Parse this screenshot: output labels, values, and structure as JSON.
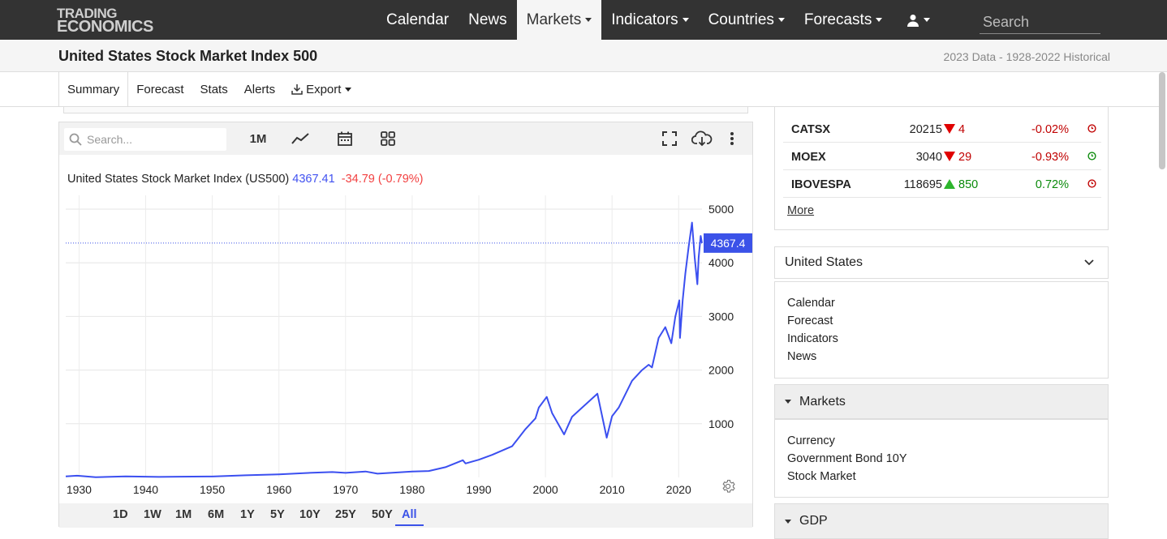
{
  "logo": {
    "line1": "TRADING",
    "line2": "ECONOMICS"
  },
  "nav": [
    {
      "label": "Calendar",
      "dropdown": false,
      "active": false
    },
    {
      "label": "News",
      "dropdown": false,
      "active": false
    },
    {
      "label": "Markets",
      "dropdown": true,
      "active": true
    },
    {
      "label": "Indicators",
      "dropdown": true,
      "active": false
    },
    {
      "label": "Countries",
      "dropdown": true,
      "active": false
    },
    {
      "label": "Forecasts",
      "dropdown": true,
      "active": false
    }
  ],
  "user_icon": "user-icon",
  "search": {
    "placeholder": "Search"
  },
  "page": {
    "title": "United States Stock Market Index 500",
    "meta": "2023 Data - 1928-2022 Historical"
  },
  "tabs": [
    "Summary",
    "Forecast",
    "Stats",
    "Alerts",
    "Export"
  ],
  "chart_toolbar": {
    "search_placeholder": "Search...",
    "interval": "1M",
    "icons": [
      "line-chart-icon",
      "calendar-icon",
      "grid-icon",
      "fullscreen-icon",
      "cloud-download-icon",
      "more-icon"
    ]
  },
  "legend": {
    "name": "United States Stock Market Index (US500)",
    "price": "4367.41",
    "change": "-34.79 (-0.79%)"
  },
  "ranges": [
    "1D",
    "1W",
    "1M",
    "6M",
    "1Y",
    "5Y",
    "10Y",
    "25Y",
    "50Y",
    "All"
  ],
  "active_range": "All",
  "colors": {
    "line": "#3b4ff0",
    "accent": "#3b52e8",
    "negative": "#c00000",
    "positive": "#0a8a0a",
    "nav_bg": "#333333"
  },
  "chart_data": {
    "type": "line",
    "title": "",
    "xlabel": "",
    "ylabel": "",
    "x_ticks": [
      "1930",
      "1940",
      "1950",
      "1960",
      "1970",
      "1980",
      "1990",
      "2000",
      "2010",
      "2020"
    ],
    "y_ticks": [
      "1000",
      "2000",
      "3000",
      "4000",
      "5000"
    ],
    "xlim": [
      1928,
      2023.5
    ],
    "ylim": [
      0,
      5000
    ],
    "last_value_label": "4367.4",
    "last_value": 4367.41,
    "series": [
      {
        "x": [
          1928,
          1929.7,
          1932.5,
          1937,
          1942,
          1945,
          1950,
          1955,
          1960,
          1965,
          1968,
          1970,
          1973,
          1974.8,
          1980,
          1982.5,
          1985,
          1987.6,
          1988,
          1990,
          1992,
          1995,
          1997,
          1998.5,
          1999,
          2000.2,
          2001,
          2002.8,
          2004,
          2007.8,
          2009.2,
          2010,
          2011,
          2013,
          2014.5,
          2015.5,
          2016,
          2017,
          2018,
          2018.9,
          2019.5,
          2020.1,
          2020.2,
          2020.6,
          2021,
          2021.5,
          2022,
          2022.4,
          2022.8,
          2023,
          2023.3,
          2023.5
        ],
        "y": [
          18,
          32,
          5,
          18,
          9,
          14,
          17,
          40,
          57,
          87,
          100,
          85,
          110,
          70,
          110,
          120,
          190,
          320,
          260,
          330,
          420,
          580,
          900,
          1100,
          1300,
          1500,
          1200,
          800,
          1130,
          1560,
          740,
          1140,
          1300,
          1800,
          2000,
          2100,
          2050,
          2600,
          2800,
          2500,
          3000,
          3300,
          2600,
          3300,
          3800,
          4300,
          4750,
          4100,
          3600,
          4100,
          4500,
          4367
        ]
      }
    ]
  },
  "markets": [
    {
      "name": "CATSX",
      "value": "20215",
      "dir": "down",
      "change": "4",
      "pct": "-0.02%"
    },
    {
      "name": "MOEX",
      "value": "3040",
      "dir": "down",
      "change": "29",
      "pct": "-0.93%"
    },
    {
      "name": "IBOVESPA",
      "value": "118695",
      "dir": "up",
      "change": "850",
      "pct": "0.72%"
    }
  ],
  "more_label": "More",
  "country_select": "United States",
  "country_links": [
    "Calendar",
    "Forecast",
    "Indicators",
    "News"
  ],
  "markets_section": {
    "title": "Markets",
    "links": [
      "Currency",
      "Government Bond 10Y",
      "Stock Market"
    ]
  },
  "gdp_section": {
    "title": "GDP"
  }
}
